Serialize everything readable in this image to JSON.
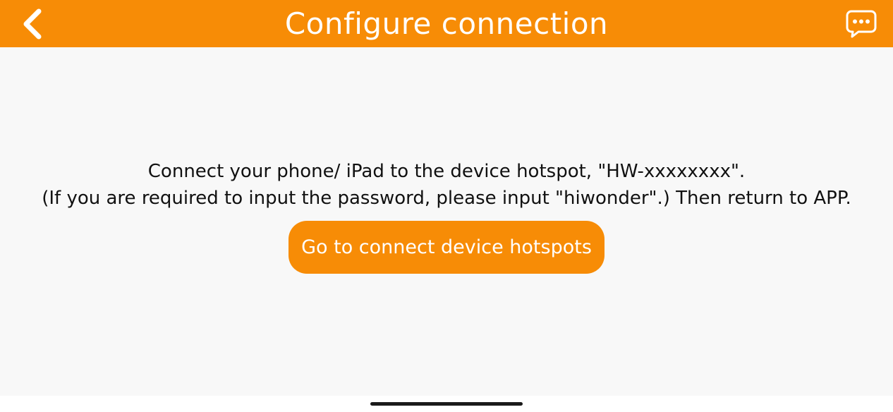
{
  "header": {
    "title": "Configure connection",
    "back_icon": "chevron-left-icon",
    "chat_icon": "chat-bubble-icon",
    "background_color": "#f78c06"
  },
  "main": {
    "instruction_line1": "Connect your phone/ iPad to the device hotspot, \"HW-xxxxxxxx\".",
    "instruction_line2": "(If you are required to input the password, please input \"hiwonder\".) Then return to APP.",
    "connect_button_label": "Go to connect device hotspots"
  },
  "colors": {
    "accent": "#f78c06",
    "background": "#f8f8f8",
    "text": "#111111"
  }
}
